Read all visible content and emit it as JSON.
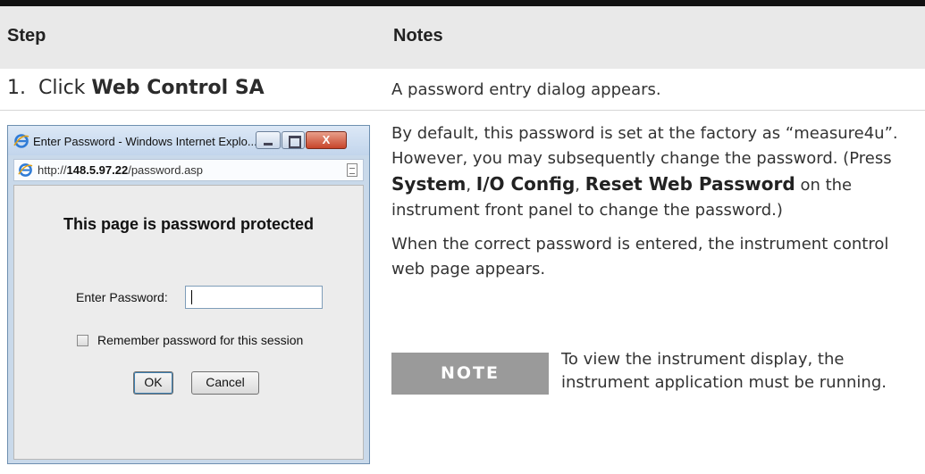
{
  "table": {
    "header": {
      "step": "Step",
      "notes": "Notes"
    },
    "row1": {
      "step_prefix": "1.  Click ",
      "step_bold": "Web Control SA",
      "note": "A password entry dialog appears."
    },
    "notes": {
      "p1_part1": "By default, this password is set at the factory as “measure4u”. However, you may subsequently change the password. (Press ",
      "p1_bold1": "System",
      "p1_sep1": ", ",
      "p1_bold2": "I/O Config",
      "p1_sep2": ", ",
      "p1_bold3": "Reset Web Password",
      "p1_part2": " on the instrument front panel to change the password.)",
      "p2": "When the correct password is entered, the instrument control web page appears.",
      "badge": "NOTE",
      "note_text": "To view the instrument display, the instrument application must be running."
    }
  },
  "dialog": {
    "title": "Enter Password - Windows Internet Explo...",
    "close_label": "X",
    "url_prefix": "http://",
    "url_host": "148.5.97.22",
    "url_path": "/password.asp",
    "heading": "This page is password protected",
    "password_label": "Enter Password:",
    "password_value": "",
    "remember_label": "Remember password for this session",
    "remember_checked": false,
    "ok_label": "OK",
    "cancel_label": "Cancel"
  }
}
